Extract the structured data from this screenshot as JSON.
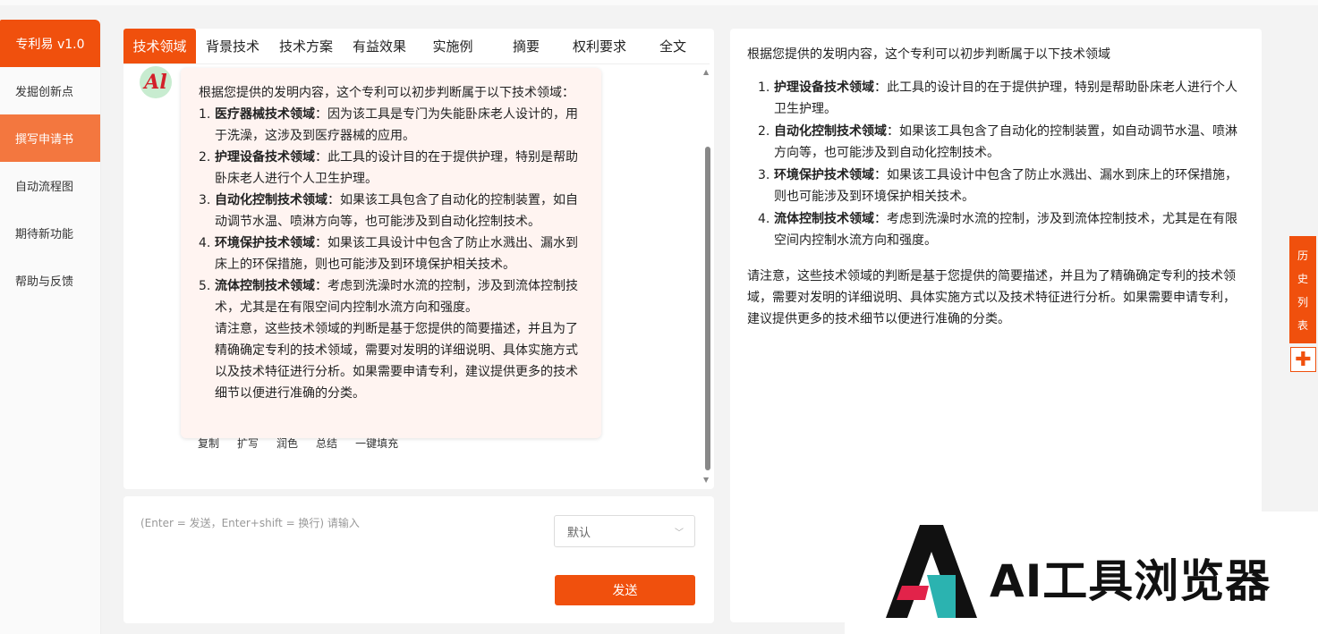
{
  "sidebar": {
    "brand": "专利易 v1.0",
    "items": [
      {
        "label": "发掘创新点"
      },
      {
        "label": "撰写申请书"
      },
      {
        "label": "自动流程图"
      },
      {
        "label": "期待新功能"
      },
      {
        "label": "帮助与反馈"
      }
    ]
  },
  "tabs": [
    "技术领域",
    "背景技术",
    "技术方案",
    "有益效果",
    "实施例",
    "摘要",
    "权利要求",
    "全文"
  ],
  "chat": {
    "intro": "根据您提供的发明内容，这个专利可以初步判断属于以下技术领域：",
    "items": [
      {
        "num": "1.",
        "title": "医疗器械技术领域",
        "text": "：因为该工具是专门为失能卧床老人设计的，用于洗澡，这涉及到医疗器械的应用。"
      },
      {
        "num": "2.",
        "title": "护理设备技术领域",
        "text": "：此工具的设计目的在于提供护理，特别是帮助卧床老人进行个人卫生护理。"
      },
      {
        "num": "3.",
        "title": "自动化控制技术领域",
        "text": "：如果该工具包含了自动化的控制装置，如自动调节水温、喷淋方向等，也可能涉及到自动化控制技术。"
      },
      {
        "num": "4.",
        "title": "环境保护技术领域",
        "text": "：如果该工具设计中包含了防止水溅出、漏水到床上的环保措施，则也可能涉及到环境保护相关技术。"
      },
      {
        "num": "5.",
        "title": "流体控制技术领域",
        "text": "：考虑到洗澡时水流的控制，涉及到流体控制技术，尤其是在有限空间内控制水流方向和强度。"
      }
    ],
    "note": "请注意，这些技术领域的判断是基于您提供的简要描述，并且为了精确确定专利的技术领域，需要对发明的详细说明、具体实施方式以及技术特征进行分析。如果需要申请专利，建议提供更多的技术细节以便进行准确的分类。",
    "actions": [
      "复制",
      "扩写",
      "润色",
      "总结",
      "一键填充"
    ]
  },
  "input": {
    "placeholder": "(Enter = 发送，Enter+shift = 换行) 请输入",
    "select_value": "默认",
    "send_label": "发送"
  },
  "result": {
    "intro": "根据您提供的发明内容，这个专利可以初步判断属于以下技术领域",
    "items": [
      {
        "num": "1.",
        "title": "护理设备技术领域",
        "text": "：此工具的设计目的在于提供护理，特别是帮助卧床老人进行个人卫生护理。"
      },
      {
        "num": "2.",
        "title": "自动化控制技术领域",
        "text": "：如果该工具包含了自动化的控制装置，如自动调节水温、喷淋方向等，也可能涉及到自动化控制技术。"
      },
      {
        "num": "3.",
        "title": "环境保护技术领域",
        "text": "：如果该工具设计中包含了防止水溅出、漏水到床上的环保措施，则也可能涉及到环境保护相关技术。"
      },
      {
        "num": "4.",
        "title": "流体控制技术领域",
        "text": "：考虑到洗澡时水流的控制，涉及到流体控制技术，尤其是在有限空间内控制水流方向和强度。"
      }
    ],
    "note": "请注意，这些技术领域的判断是基于您提供的简要描述，并且为了精确确定专利的技术领域，需要对发明的详细说明、具体实施方式以及技术特征进行分析。如果需要申请专利，建议提供更多的技术细节以便进行准确的分类。"
  },
  "history": [
    "历",
    "史",
    "列",
    "表"
  ],
  "watermark": {
    "text": "AI工具浏览器"
  },
  "colors": {
    "accent": "#f0500d",
    "accent_light": "#f3773f",
    "bubble": "#fff4f1"
  },
  "icons": {
    "avatar": "ai-logo-icon",
    "plus": "plus-icon",
    "chevron": "chevron-down-icon"
  }
}
